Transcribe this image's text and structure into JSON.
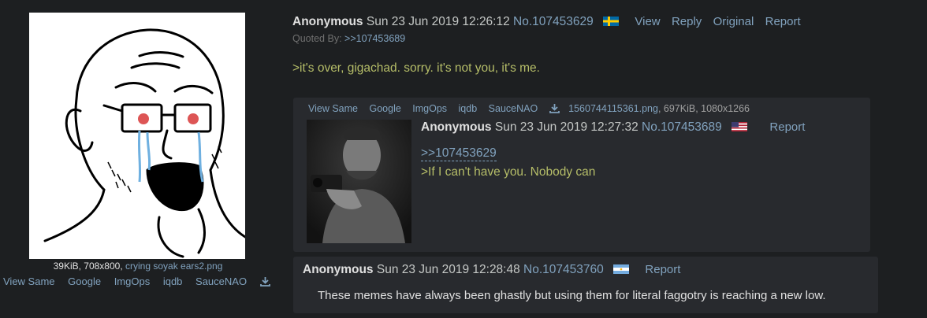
{
  "op": {
    "file_info": "39KiB, 708x800, ",
    "file_name": "crying soyak ears2.png",
    "image_links": [
      "View Same",
      "Google",
      "ImgOps",
      "iqdb",
      "SauceNAO"
    ],
    "name": "Anonymous",
    "date": "Sun 23 Jun 2019 12:26:12",
    "post_no": "No.107453629",
    "flag": "sweden-flag",
    "actions": [
      "View",
      "Reply",
      "Original",
      "Report"
    ],
    "quoted_by_label": "Quoted By: ",
    "quoted_by_link": ">>107453689",
    "text": ">it's over, gigachad. sorry. it's not you, it's me."
  },
  "reply1": {
    "image_links": [
      "View Same",
      "Google",
      "ImgOps",
      "iqdb",
      "SauceNAO"
    ],
    "file_name": "1560744115361.png",
    "file_meta": ", 697KiB, 1080x1266",
    "name": "Anonymous",
    "date": "Sun 23 Jun 2019 12:27:32",
    "post_no": "No.107453689",
    "flag": "usa-flag",
    "report": "Report",
    "quote_link": ">>107453629",
    "text": ">If I can't have you. Nobody can"
  },
  "reply2": {
    "name": "Anonymous",
    "date": "Sun 23 Jun 2019 12:28:48",
    "post_no": "No.107453760",
    "flag": "argentina-flag",
    "report": "Report",
    "text": "These memes have always been ghastly but using them for literal faggotry is reaching a new low."
  },
  "colors": {
    "background": "#1d1f21",
    "post_background": "#282a2e",
    "link": "#81a2be",
    "greentext": "#b5bd68",
    "text": "#c5c8c6"
  }
}
